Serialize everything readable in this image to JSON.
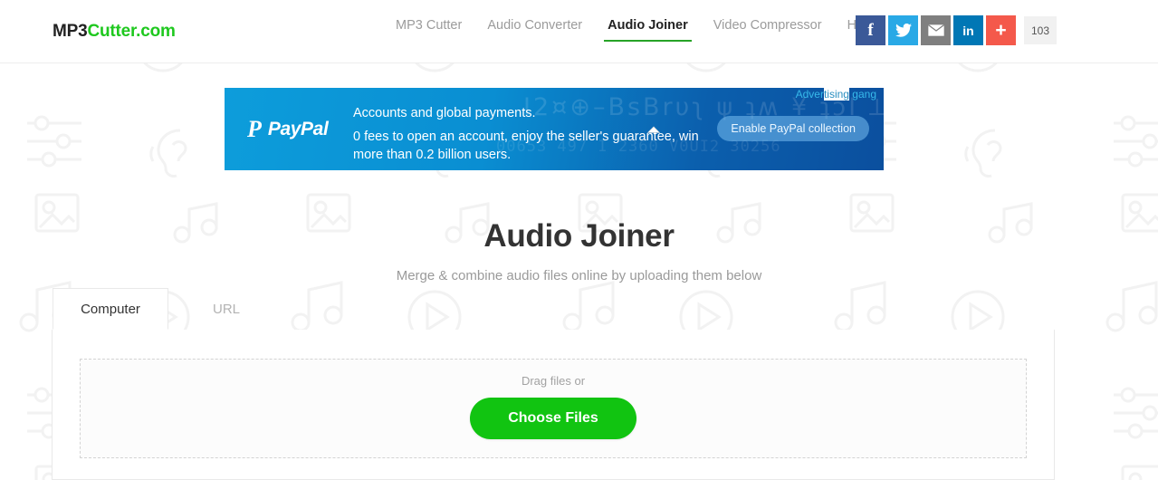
{
  "site": {
    "logo_primary": "MP3",
    "logo_secondary": "Cutter.com"
  },
  "nav": {
    "items": [
      {
        "label": "MP3 Cutter",
        "active": false
      },
      {
        "label": "Audio Converter",
        "active": false
      },
      {
        "label": "Audio Joiner",
        "active": true
      },
      {
        "label": "Video Compressor",
        "active": false
      },
      {
        "label": "Help",
        "active": false
      }
    ]
  },
  "social": {
    "facebook": "f",
    "twitter": "twitter-bird",
    "email": "envelope",
    "linkedin": "in",
    "share": "+",
    "count": "103"
  },
  "ad": {
    "brand_mark": "P",
    "brand_name": "PayPal",
    "headline": "Accounts and global payments.",
    "body": "0 fees to open an account, enjoy the seller's guarantee, win more than 0.2 billion users.",
    "cta": "Enable PayPal collection",
    "label_part1": "Adver",
    "label_part2": "tising",
    "label_part3": " gang",
    "deco_text": "I2¤⊕–BsBrυʅ ψ ʇʍ ¥ ʇɔI ⟂ ƗT┐",
    "deco_text2": "00653 497 I 2360 V0UI2 30256"
  },
  "hero": {
    "title": "Audio Joiner",
    "subtitle": "Merge & combine audio files online by uploading them below"
  },
  "panel": {
    "tabs": [
      {
        "label": "Computer",
        "active": true
      },
      {
        "label": "URL",
        "active": false
      }
    ],
    "dropzone": {
      "hint": "Drag files or",
      "button": "Choose Files"
    }
  },
  "colors": {
    "brand_green": "#1ec81e",
    "button_green": "#11c411",
    "nav_active": "#27a327",
    "facebook": "#3b5998",
    "twitter": "#29a9e6",
    "email": "#7f7f7f",
    "linkedin": "#0077b5",
    "share": "#f4594b",
    "ad_blue": "#0d9ddb"
  }
}
